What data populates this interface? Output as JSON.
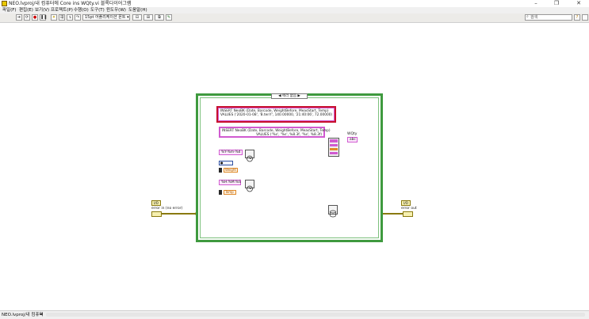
{
  "window": {
    "title": "NEO.lvproj/내 컴퓨터에 Core ins WQty.vi 블록다이어그램",
    "controls": [
      "minimize",
      "restore",
      "close"
    ]
  },
  "menu": [
    "파일(F)",
    "편집(E)",
    "보기(V)",
    "프로젝트(P)",
    "수행(O)",
    "도구(T)",
    "윈도우(W)",
    "도움말(H)"
  ],
  "toolbar": {
    "font_select": "15pt 어플리케이션 폰트",
    "search_placeholder": "검색"
  },
  "diagram": {
    "case_selector": "에러 없음",
    "sql_highlight": {
      "line1": "INSERT NeoBK (Date, Barcode, WeightBefore, MeasStart, Temp)",
      "line2": "VALUES ('2020-01-08', 'B.tenY', 140.00000, '21:40:06', 72.00000)"
    },
    "sql_template": {
      "line1": "INSERT NeoBK (Date, Barcode, WeightBefore, MeasStart, Temp)",
      "line2": "VALUES ('%s', '%s', %8.3f, '%s', %8.3f)"
    },
    "date_format": "%Y-%m-%d",
    "time_format": "%H:%M:%S",
    "wqty_label": "WQty",
    "wqty_indicator": "abc",
    "error_in_type": "I/O",
    "error_in_label": "error in (no error)",
    "error_out_type": "I/O",
    "error_out_label": "error out",
    "weight_term": "Weight",
    "temp_term": "Temp"
  },
  "status": {
    "path": "NEO.lvproj/내 컴퓨터"
  },
  "colors": {
    "case_border": "#3f9a3f",
    "string_wire": "#d05ad0",
    "numeric_wire": "#e08a2a",
    "error_wire": "#8a7a10",
    "highlight": "#c8102e"
  }
}
